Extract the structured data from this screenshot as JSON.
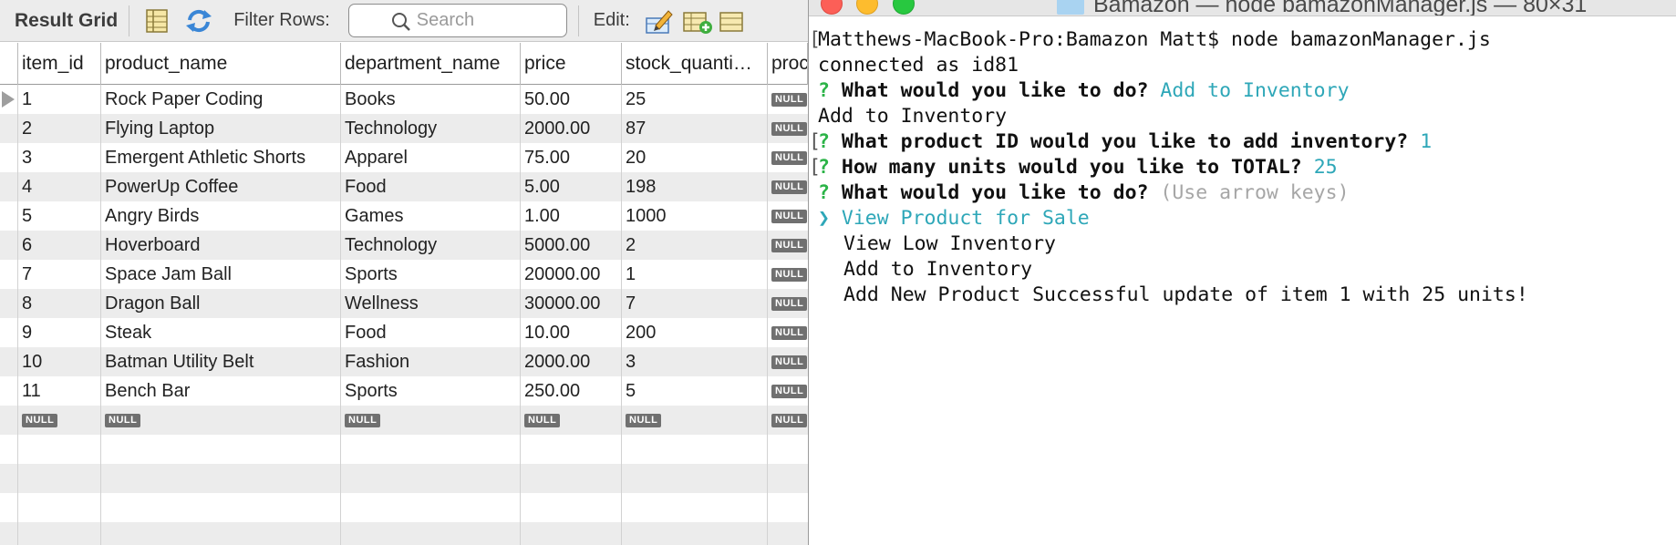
{
  "grid": {
    "toolbar": {
      "title": "Result Grid",
      "filter_label": "Filter Rows:",
      "search_placeholder": "Search",
      "edit_label": "Edit:"
    },
    "columns": [
      "item_id",
      "product_name",
      "department_name",
      "price",
      "stock_quanti…",
      "proc"
    ],
    "rows": [
      {
        "item_id": "1",
        "product_name": "Rock Paper Coding",
        "department_name": "Books",
        "price": "50.00",
        "stock_quantity": "25",
        "extra": "NULL"
      },
      {
        "item_id": "2",
        "product_name": "Flying Laptop",
        "department_name": "Technology",
        "price": "2000.00",
        "stock_quantity": "87",
        "extra": "NULL"
      },
      {
        "item_id": "3",
        "product_name": "Emergent Athletic Shorts",
        "department_name": "Apparel",
        "price": "75.00",
        "stock_quantity": "20",
        "extra": "NULL"
      },
      {
        "item_id": "4",
        "product_name": "PowerUp Coffee",
        "department_name": "Food",
        "price": "5.00",
        "stock_quantity": "198",
        "extra": "NULL"
      },
      {
        "item_id": "5",
        "product_name": "Angry Birds",
        "department_name": "Games",
        "price": "1.00",
        "stock_quantity": "1000",
        "extra": "NULL"
      },
      {
        "item_id": "6",
        "product_name": "Hoverboard",
        "department_name": "Technology",
        "price": "5000.00",
        "stock_quantity": "2",
        "extra": "NULL"
      },
      {
        "item_id": "7",
        "product_name": "Space Jam Ball",
        "department_name": "Sports",
        "price": "20000.00",
        "stock_quantity": "1",
        "extra": "NULL"
      },
      {
        "item_id": "8",
        "product_name": "Dragon Ball",
        "department_name": "Wellness",
        "price": "30000.00",
        "stock_quantity": "7",
        "extra": "NULL"
      },
      {
        "item_id": "9",
        "product_name": "Steak",
        "department_name": "Food",
        "price": "10.00",
        "stock_quantity": "200",
        "extra": "NULL"
      },
      {
        "item_id": "10",
        "product_name": "Batman Utility Belt",
        "department_name": "Fashion",
        "price": "2000.00",
        "stock_quantity": "3",
        "extra": "NULL"
      },
      {
        "item_id": "11",
        "product_name": "Bench Bar",
        "department_name": "Sports",
        "price": "250.00",
        "stock_quantity": "5",
        "extra": "NULL"
      }
    ],
    "null_text": "NULL"
  },
  "terminal": {
    "title": "Bamazon — node bamazonManager.js — 80×31",
    "lines": {
      "l1": "Matthews-MacBook-Pro:Bamazon Matt$ node bamazonManager.js",
      "l2": "connected as id81",
      "l3_mark": "?",
      "l3_q": "What would you like to do?",
      "l3_a": "Add to Inventory",
      "l4": "Add to Inventory",
      "l5_mark": "?",
      "l5_q": "What product ID would you like to add inventory?",
      "l5_a": "1",
      "l6_mark": "?",
      "l6_q": "How many units would you like to TOTAL?",
      "l6_a": "25",
      "l7_mark": "?",
      "l7_q": "What would you like to do?",
      "l7_hint": "(Use arrow keys)",
      "l8_pointer": "❯",
      "l8": "View Product for Sale",
      "l9": "View Low Inventory",
      "l10": "Add to Inventory",
      "l11": "Add New Product Successful update of item 1 with 25 units!"
    }
  },
  "colors": {
    "prompt_mark": "#2bb347",
    "answer": "#2ea7b8",
    "hint": "#a6a6a6",
    "null_badge": "#707070"
  }
}
